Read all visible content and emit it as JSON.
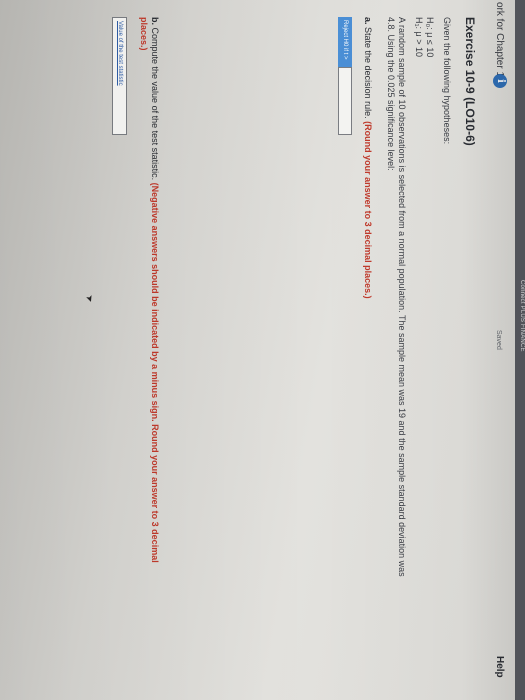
{
  "topbar": {
    "text": "Connect PLUS FINANCE"
  },
  "header": {
    "breadcrumb": "ork for Chapter 10",
    "info_icon": "i",
    "saved": "Saved",
    "help": "Help"
  },
  "exercise": {
    "title": "Exercise 10-9 (LO10-6)",
    "given": "Given the following hypotheses:",
    "h0": "H₀: μ ≤ 10",
    "h1": "H₁: μ > 10",
    "paragraph": "A random sample of 10 observations is selected from a normal population. The sample mean was 19 and the sample standard deviation was 4.8. Using the 0.025 significance level:"
  },
  "part_a": {
    "label": "a.",
    "text": "State the decision rule.",
    "instruction": "(Round your answer to 3 decimal places.)",
    "dropdown": "Reject H0 if t >",
    "input_value": ""
  },
  "part_b": {
    "label": "b.",
    "text": "Compute the value of the test statistic.",
    "instruction": "(Negative answers should be indicated by a minus sign. Round your answer to 3 decimal places.)",
    "input_placeholder": "Value of the test statistic"
  },
  "colors": {
    "accent": "#4a8fd6",
    "emphasis": "#c0392b",
    "info": "#2f6fb7"
  }
}
